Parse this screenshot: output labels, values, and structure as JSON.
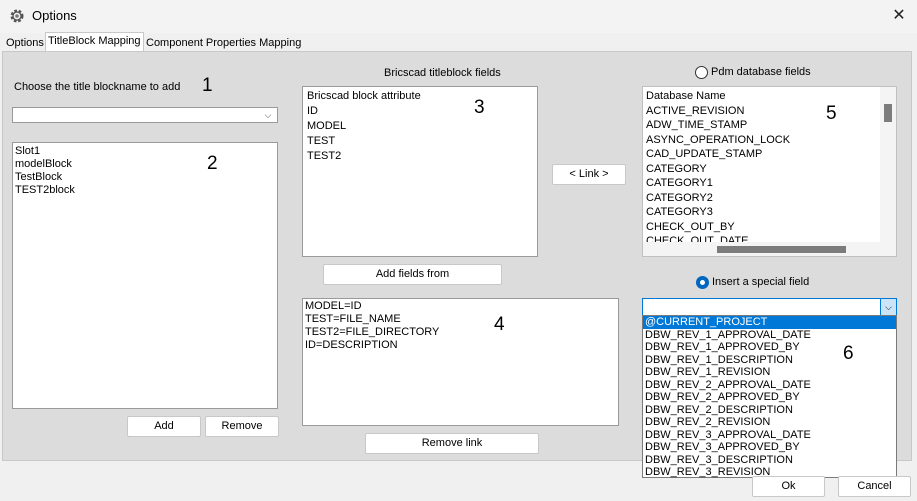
{
  "window": {
    "title": "Options",
    "close_glyph": "✕"
  },
  "tabs": [
    "Options",
    "TitleBlock Mapping",
    "Component Properties Mapping"
  ],
  "annotations": [
    "1",
    "2",
    "3",
    "4",
    "5",
    "6"
  ],
  "left": {
    "choose_label": "Choose the title blockname to add",
    "blockname_value": "",
    "blocknames": [
      "Slot1",
      "modelBlock",
      "TestBlock",
      "TEST2block"
    ],
    "add_label": "Add",
    "remove_label": "Remove"
  },
  "middle": {
    "fields_title": "Bricscad titleblock fields",
    "fields_header": "Bricscad block attribute",
    "fields": [
      "ID",
      "MODEL",
      "TEST",
      "TEST2"
    ],
    "add_fields_label": "Add fields from",
    "mappings": [
      "MODEL=ID",
      "TEST=FILE_NAME",
      "TEST2=FILE_DIRECTORY",
      "ID=DESCRIPTION"
    ],
    "remove_link_label": "Remove link",
    "link_label": "< Link >"
  },
  "right": {
    "pdm_radio_label": "Pdm database fields",
    "db_header": "Database Name",
    "db_fields": [
      "ACTIVE_REVISION",
      "ADW_TIME_STAMP",
      "ASYNC_OPERATION_LOCK",
      "CAD_UPDATE_STAMP",
      "CATEGORY",
      "CATEGORY1",
      "CATEGORY2",
      "CATEGORY3",
      "CHECK_OUT_BY",
      "CHECK_OUT_DATE"
    ],
    "special_radio_label": "Insert a special field",
    "special_value": "",
    "special_options": [
      "@CURRENT_PROJECT",
      "DBW_REV_1_APPROVAL_DATE",
      "DBW_REV_1_APPROVED_BY",
      "DBW_REV_1_DESCRIPTION",
      "DBW_REV_1_REVISION",
      "DBW_REV_2_APPROVAL_DATE",
      "DBW_REV_2_APPROVED_BY",
      "DBW_REV_2_DESCRIPTION",
      "DBW_REV_2_REVISION",
      "DBW_REV_3_APPROVAL_DATE",
      "DBW_REV_3_APPROVED_BY",
      "DBW_REV_3_DESCRIPTION",
      "DBW_REV_3_REVISION"
    ],
    "special_selected_index": 0
  },
  "footer": {
    "ok_label": "Ok",
    "cancel_label": "Cancel"
  },
  "colors": {
    "accent": "#0078d7",
    "panel": "#dcdcdc",
    "window": "#f0f0f0"
  },
  "icons": {
    "app": "gear-icon",
    "close": "close-icon",
    "combo": "chevron-down-icon"
  }
}
